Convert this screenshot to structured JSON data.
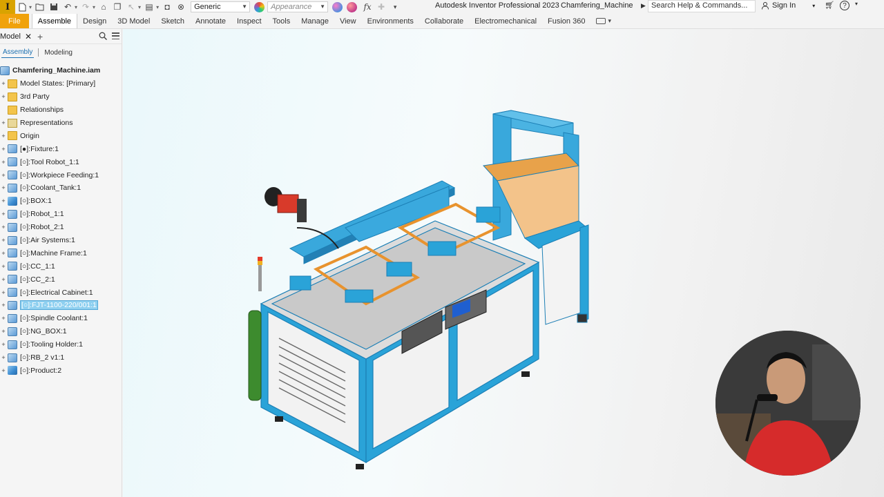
{
  "qat": {
    "material_value": "Generic",
    "appearance_placeholder": "Appearance",
    "fx_label": "fx",
    "app_title": "Autodesk Inventor Professional 2023",
    "doc_title": "Chamfering_Machine",
    "search_placeholder": "Search Help & Commands...",
    "signin_label": "Sign In",
    "logo_letter": "I"
  },
  "ribbon": {
    "tabs": [
      "File",
      "Assemble",
      "Design",
      "3D Model",
      "Sketch",
      "Annotate",
      "Inspect",
      "Tools",
      "Manage",
      "View",
      "Environments",
      "Collaborate",
      "Electromechanical",
      "Fusion 360"
    ],
    "active_tab": "Assemble"
  },
  "browser": {
    "panel_tab": "Model",
    "subtabs": [
      "Assembly",
      "Modeling"
    ],
    "active_subtab": "Assembly",
    "root": "Chamfering_Machine.iam",
    "items": [
      {
        "label": "Model States: [Primary]",
        "icon": "folder-icon"
      },
      {
        "label": "3rd Party",
        "icon": "folder-icon"
      },
      {
        "label": "Relationships",
        "icon": "folder-icon"
      },
      {
        "label": "Representations",
        "icon": "representations-icon"
      },
      {
        "label": "Origin",
        "icon": "folder-icon"
      },
      {
        "label": "[●]:Fixture:1",
        "icon": "assembly-icon"
      },
      {
        "label": "[○]:Tool Robot_1:1",
        "icon": "assembly-icon"
      },
      {
        "label": "[○]:Workpiece Feeding:1",
        "icon": "assembly-icon"
      },
      {
        "label": "[○]:Coolant_Tank:1",
        "icon": "assembly-icon"
      },
      {
        "label": "[○]:BOX:1",
        "icon": "part-icon"
      },
      {
        "label": "[○]:Robot_1:1",
        "icon": "assembly-icon"
      },
      {
        "label": "[○]:Robot_2:1",
        "icon": "assembly-icon"
      },
      {
        "label": "[○]:Air Systems:1",
        "icon": "assembly-icon"
      },
      {
        "label": "[○]:Machine Frame:1",
        "icon": "assembly-icon"
      },
      {
        "label": "[○]:CC_1:1",
        "icon": "assembly-icon"
      },
      {
        "label": "[○]:CC_2:1",
        "icon": "assembly-icon"
      },
      {
        "label": "[○]:Electrical Cabinet:1",
        "icon": "assembly-icon"
      },
      {
        "label": "[○]:FJT-1100-220/001:1",
        "icon": "assembly-icon",
        "selected": true
      },
      {
        "label": "[○]:Spindle Coolant:1",
        "icon": "assembly-icon"
      },
      {
        "label": "[○]:NG_BOX:1",
        "icon": "assembly-icon"
      },
      {
        "label": "[○]:Tooling Holder:1",
        "icon": "assembly-icon"
      },
      {
        "label": "[○]:RB_2 v1:1",
        "icon": "assembly-icon"
      },
      {
        "label": "[○]:Product:2",
        "icon": "part-icon"
      }
    ]
  },
  "colors": {
    "file_tab": "#f0a20b",
    "frame_blue": "#2aa3d8",
    "panel_white": "#f4f4f4",
    "orange_frame": "#e8932e",
    "selection": "#8fd0f0"
  }
}
